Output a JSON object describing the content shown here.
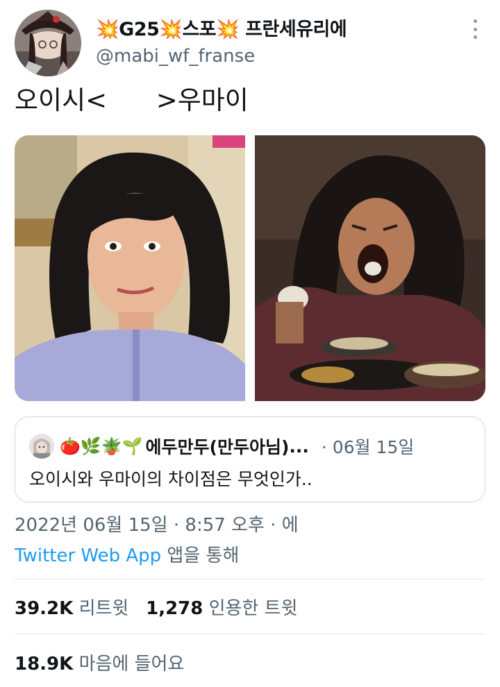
{
  "author": {
    "display_name": "💥G25💥스포💥 프란세유리에",
    "handle": "@mabi_wf_franse",
    "avatar_icon": "profile-avatar"
  },
  "tweet": {
    "text": "오이시<      >우마이"
  },
  "media": {
    "count": 2,
    "photos": [
      "photo-left",
      "photo-right"
    ]
  },
  "quote": {
    "emojis": "🍅🌿🪴🌱",
    "name": "에두만두(만두아님)",
    "ellipsis": "...",
    "date": "· 06월 15일",
    "text": "오이시와 우마이의 차이점은 무엇인가.."
  },
  "meta": {
    "timestamp": "2022년 06월 15일 · 8:57 오후 · 에",
    "source_app": "Twitter Web App",
    "source_suffix": " 앱을 통해"
  },
  "stats": {
    "retweets": "39.2K",
    "retweets_label": "리트윗",
    "quotes": "1,278",
    "quotes_label": "인용한 트윗",
    "likes": "18.9K",
    "likes_label": "마음에 들어요"
  },
  "colors": {
    "link": "#1d9bf0",
    "secondary_text": "#536471",
    "border": "#cfd9de"
  }
}
